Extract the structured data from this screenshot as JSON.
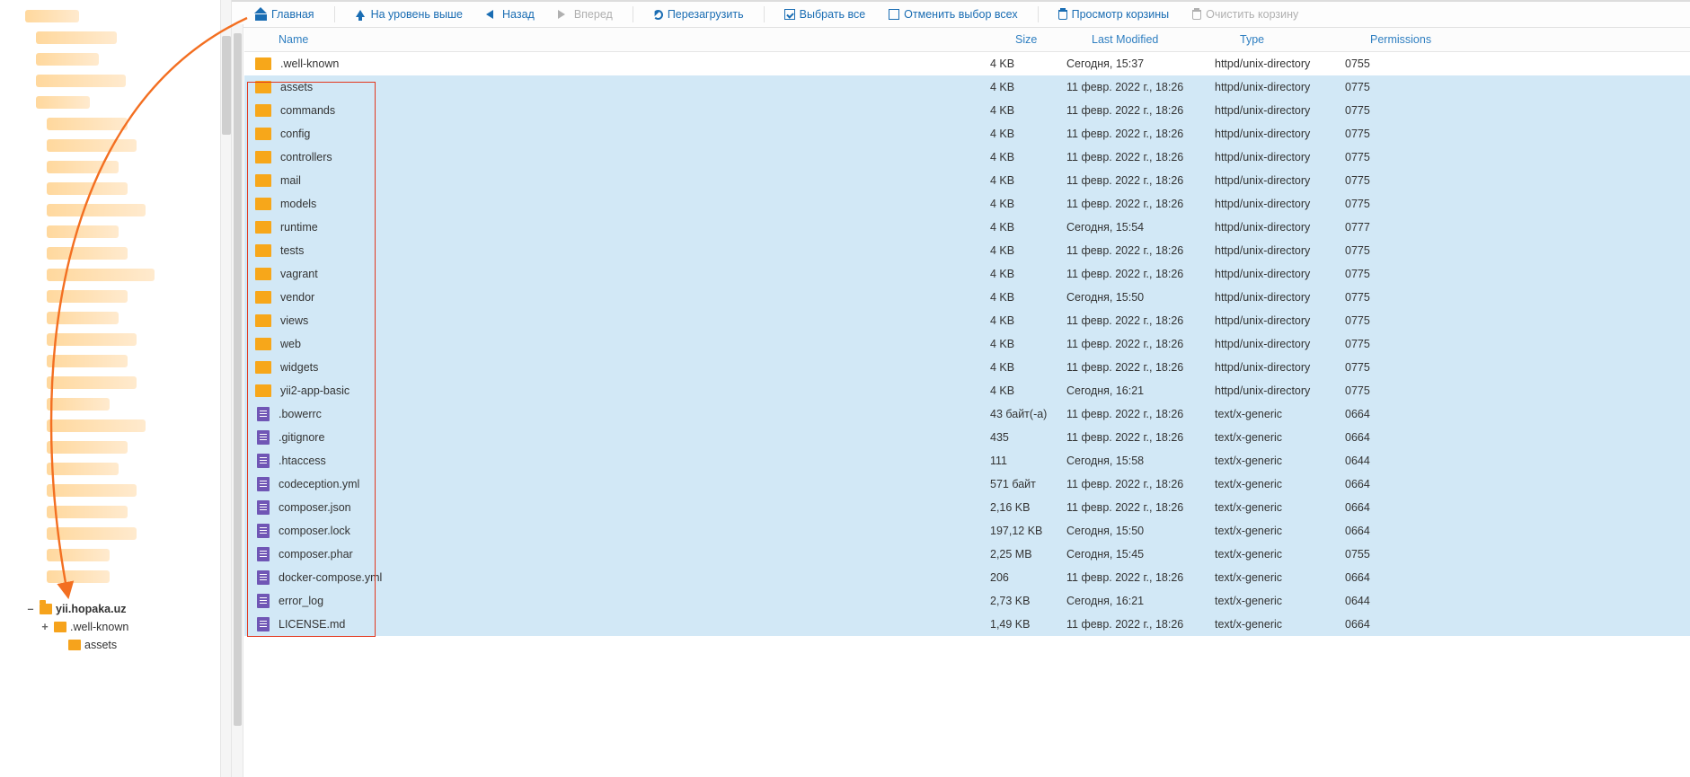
{
  "toolbar": {
    "home": "Главная",
    "up": "На уровень выше",
    "back": "Назад",
    "forward": "Вперед",
    "reload": "Перезагрузить",
    "select_all": "Выбрать все",
    "deselect_all": "Отменить выбор всех",
    "view_trash": "Просмотр корзины",
    "empty_trash": "Очистить корзину"
  },
  "columns": {
    "name": "Name",
    "size": "Size",
    "modified": "Last Modified",
    "type": "Type",
    "permissions": "Permissions"
  },
  "tree": {
    "root": "yii.hopaka.uz",
    "children": [
      {
        "name": ".well-known",
        "toggle": "+"
      },
      {
        "name": "assets",
        "toggle": ""
      }
    ]
  },
  "rows": [
    {
      "icon": "folder",
      "name": ".well-known",
      "size": "4 KB",
      "modified": "Сегодня, 15:37",
      "type": "httpd/unix-directory",
      "perm": "0755",
      "sel": false
    },
    {
      "icon": "folder",
      "name": "assets",
      "size": "4 KB",
      "modified": "11 февр. 2022 г., 18:26",
      "type": "httpd/unix-directory",
      "perm": "0775",
      "sel": true
    },
    {
      "icon": "folder",
      "name": "commands",
      "size": "4 KB",
      "modified": "11 февр. 2022 г., 18:26",
      "type": "httpd/unix-directory",
      "perm": "0775",
      "sel": true
    },
    {
      "icon": "folder",
      "name": "config",
      "size": "4 KB",
      "modified": "11 февр. 2022 г., 18:26",
      "type": "httpd/unix-directory",
      "perm": "0775",
      "sel": true
    },
    {
      "icon": "folder",
      "name": "controllers",
      "size": "4 KB",
      "modified": "11 февр. 2022 г., 18:26",
      "type": "httpd/unix-directory",
      "perm": "0775",
      "sel": true
    },
    {
      "icon": "folder",
      "name": "mail",
      "size": "4 KB",
      "modified": "11 февр. 2022 г., 18:26",
      "type": "httpd/unix-directory",
      "perm": "0775",
      "sel": true
    },
    {
      "icon": "folder",
      "name": "models",
      "size": "4 KB",
      "modified": "11 февр. 2022 г., 18:26",
      "type": "httpd/unix-directory",
      "perm": "0775",
      "sel": true
    },
    {
      "icon": "folder",
      "name": "runtime",
      "size": "4 KB",
      "modified": "Сегодня, 15:54",
      "type": "httpd/unix-directory",
      "perm": "0777",
      "sel": true
    },
    {
      "icon": "folder",
      "name": "tests",
      "size": "4 KB",
      "modified": "11 февр. 2022 г., 18:26",
      "type": "httpd/unix-directory",
      "perm": "0775",
      "sel": true
    },
    {
      "icon": "folder",
      "name": "vagrant",
      "size": "4 KB",
      "modified": "11 февр. 2022 г., 18:26",
      "type": "httpd/unix-directory",
      "perm": "0775",
      "sel": true
    },
    {
      "icon": "folder",
      "name": "vendor",
      "size": "4 KB",
      "modified": "Сегодня, 15:50",
      "type": "httpd/unix-directory",
      "perm": "0775",
      "sel": true
    },
    {
      "icon": "folder",
      "name": "views",
      "size": "4 KB",
      "modified": "11 февр. 2022 г., 18:26",
      "type": "httpd/unix-directory",
      "perm": "0775",
      "sel": true
    },
    {
      "icon": "folder",
      "name": "web",
      "size": "4 KB",
      "modified": "11 февр. 2022 г., 18:26",
      "type": "httpd/unix-directory",
      "perm": "0775",
      "sel": true
    },
    {
      "icon": "folder",
      "name": "widgets",
      "size": "4 KB",
      "modified": "11 февр. 2022 г., 18:26",
      "type": "httpd/unix-directory",
      "perm": "0775",
      "sel": true
    },
    {
      "icon": "folder",
      "name": "yii2-app-basic",
      "size": "4 KB",
      "modified": "Сегодня, 16:21",
      "type": "httpd/unix-directory",
      "perm": "0775",
      "sel": true
    },
    {
      "icon": "file",
      "name": ".bowerrc",
      "size": "43 байт(-а)",
      "modified": "11 февр. 2022 г., 18:26",
      "type": "text/x-generic",
      "perm": "0664",
      "sel": true
    },
    {
      "icon": "file",
      "name": ".gitignore",
      "size": "435",
      "modified": "11 февр. 2022 г., 18:26",
      "type": "text/x-generic",
      "perm": "0664",
      "sel": true
    },
    {
      "icon": "file",
      "name": ".htaccess",
      "size": "111",
      "modified": "Сегодня, 15:58",
      "type": "text/x-generic",
      "perm": "0644",
      "sel": true
    },
    {
      "icon": "file",
      "name": "codeception.yml",
      "size": "571 байт",
      "modified": "11 февр. 2022 г., 18:26",
      "type": "text/x-generic",
      "perm": "0664",
      "sel": true
    },
    {
      "icon": "file",
      "name": "composer.json",
      "size": "2,16 KB",
      "modified": "11 февр. 2022 г., 18:26",
      "type": "text/x-generic",
      "perm": "0664",
      "sel": true
    },
    {
      "icon": "file",
      "name": "composer.lock",
      "size": "197,12 KB",
      "modified": "Сегодня, 15:50",
      "type": "text/x-generic",
      "perm": "0664",
      "sel": true
    },
    {
      "icon": "file",
      "name": "composer.phar",
      "size": "2,25 MB",
      "modified": "Сегодня, 15:45",
      "type": "text/x-generic",
      "perm": "0755",
      "sel": true
    },
    {
      "icon": "file",
      "name": "docker-compose.yml",
      "size": "206",
      "modified": "11 февр. 2022 г., 18:26",
      "type": "text/x-generic",
      "perm": "0664",
      "sel": true
    },
    {
      "icon": "file",
      "name": "error_log",
      "size": "2,73 KB",
      "modified": "Сегодня, 16:21",
      "type": "text/x-generic",
      "perm": "0644",
      "sel": true
    },
    {
      "icon": "file",
      "name": "LICENSE.md",
      "size": "1,49 KB",
      "modified": "11 февр. 2022 г., 18:26",
      "type": "text/x-generic",
      "perm": "0664",
      "sel": true
    }
  ]
}
